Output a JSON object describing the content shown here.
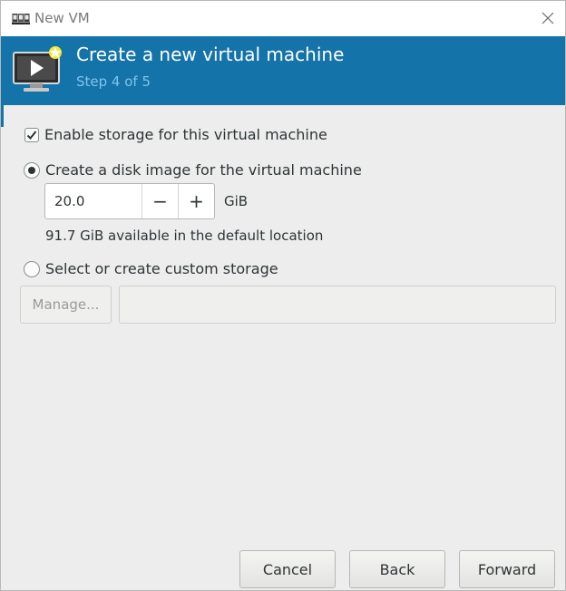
{
  "window": {
    "title": "New VM",
    "app_icon": "virt-manager-icon",
    "close_icon": "close-icon"
  },
  "header": {
    "title": "Create a new virtual machine",
    "step": "Step 4 of 5",
    "icon": "vm-screen-icon",
    "background_color": "#1473a8",
    "step_color": "#7ec5ee"
  },
  "storage": {
    "enable_label": "Enable storage for this virtual machine",
    "enable_checked": true,
    "create_disk_label": "Create a disk image for the virtual machine",
    "create_disk_selected": true,
    "size_value": "20.0",
    "decrement_label": "−",
    "increment_label": "+",
    "size_unit": "GiB",
    "available_text": "91.7 GiB available in the default location",
    "custom_label": "Select or create custom storage",
    "custom_selected": false,
    "manage_label": "Manage...",
    "custom_path_value": ""
  },
  "footer": {
    "cancel_label": "Cancel",
    "back_label": "Back",
    "forward_label": "Forward"
  }
}
